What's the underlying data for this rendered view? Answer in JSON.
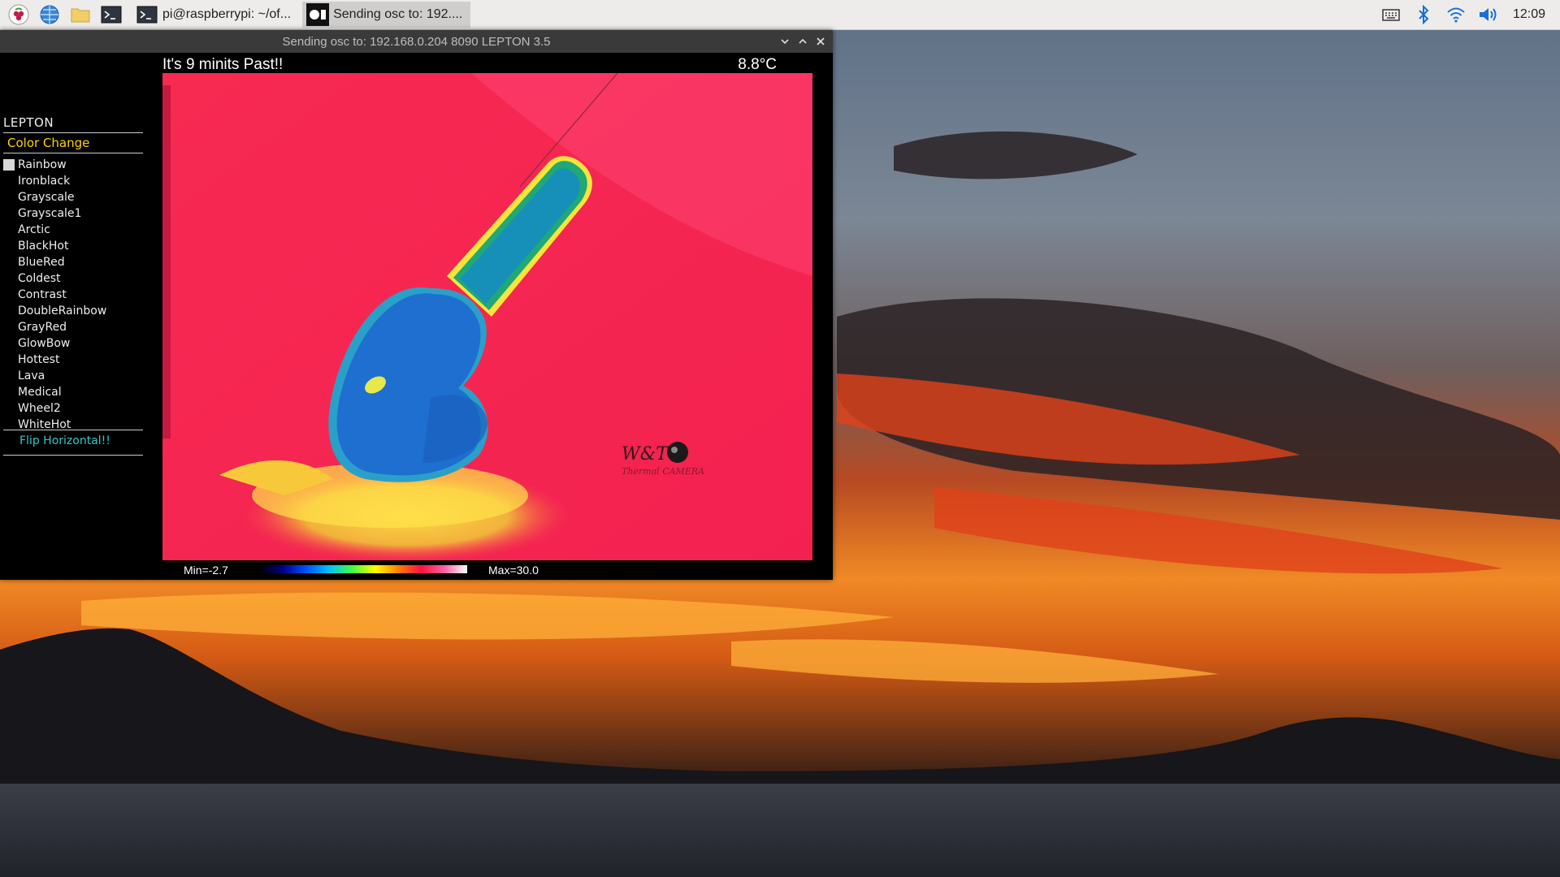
{
  "taskbar": {
    "launchers": [
      "raspberry-menu-icon",
      "web-browser-icon",
      "file-manager-icon",
      "terminal-icon"
    ],
    "tasks": [
      {
        "label": "pi@raspberrypi: ~/of...",
        "icon": "terminal-icon",
        "active": false
      },
      {
        "label": "Sending osc to: 192....",
        "icon": "openframeworks-icon",
        "active": true
      }
    ],
    "tray": [
      "keyboard-icon",
      "bluetooth-icon",
      "wifi-icon",
      "volume-icon"
    ],
    "clock": "12:09"
  },
  "window": {
    "title": "Sending osc to: 192.168.0.204 8090 LEPTON 3.5",
    "controls": [
      "minimize",
      "maximize",
      "close"
    ]
  },
  "sidebar": {
    "title": "LEPTON",
    "section": "Color Change",
    "palettes": [
      {
        "label": "Rainbow",
        "selected": true
      },
      {
        "label": "Ironblack",
        "selected": false
      },
      {
        "label": "Grayscale",
        "selected": false
      },
      {
        "label": "Grayscale1",
        "selected": false
      },
      {
        "label": "Arctic",
        "selected": false
      },
      {
        "label": "BlackHot",
        "selected": false
      },
      {
        "label": "BlueRed",
        "selected": false
      },
      {
        "label": "Coldest",
        "selected": false
      },
      {
        "label": "Contrast",
        "selected": false
      },
      {
        "label": "DoubleRainbow",
        "selected": false
      },
      {
        "label": "GrayRed",
        "selected": false
      },
      {
        "label": "GlowBow",
        "selected": false
      },
      {
        "label": "Hottest",
        "selected": false
      },
      {
        "label": "Lava",
        "selected": false
      },
      {
        "label": "Medical",
        "selected": false
      },
      {
        "label": "Wheel2",
        "selected": false
      },
      {
        "label": "WhiteHot",
        "selected": false
      }
    ],
    "flip_label": "Flip Horizontal!!"
  },
  "view": {
    "message": "It's 9 minits Past!!",
    "temperature": "8.8°C",
    "min_label": "Min=-2.7",
    "max_label": "Max=30.0",
    "watermark": "W&T Thermal CAMERA"
  },
  "colors": {
    "accent_yellow": "#ffd400",
    "flip_cyan": "#2fc8c8",
    "thermal_background": "#f4234f"
  }
}
